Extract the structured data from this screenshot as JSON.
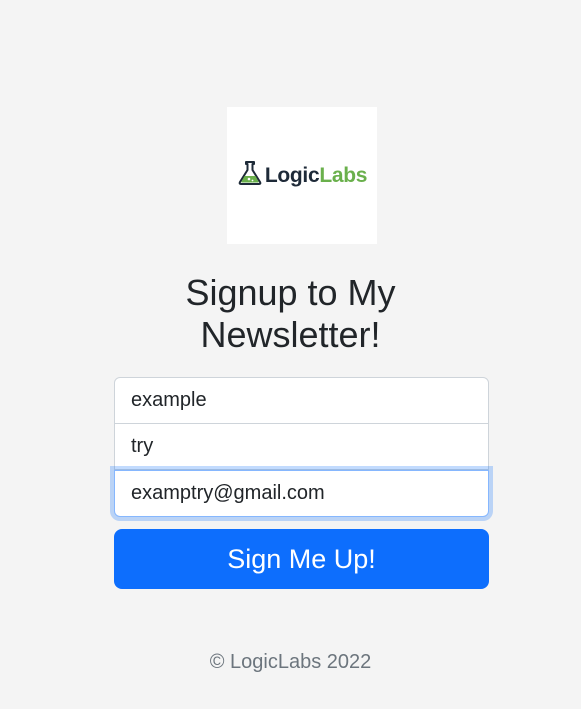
{
  "logo": {
    "text_part1": "Logic",
    "text_part2": "Labs",
    "icon": "flask-icon",
    "colors": {
      "dark": "#1e2a38",
      "green": "#6ab04c"
    }
  },
  "heading": {
    "line1": "Signup to My",
    "line2": "Newsletter!"
  },
  "form": {
    "first_name_value": "example",
    "last_name_value": "try",
    "email_value": "examptry@gmail.com"
  },
  "button": {
    "label": "Sign Me Up!"
  },
  "footer": {
    "text": "© LogicLabs 2022"
  },
  "colors": {
    "background": "#f4f4f4",
    "primary": "#0d6efd",
    "focus_ring": "#86b7fe"
  }
}
